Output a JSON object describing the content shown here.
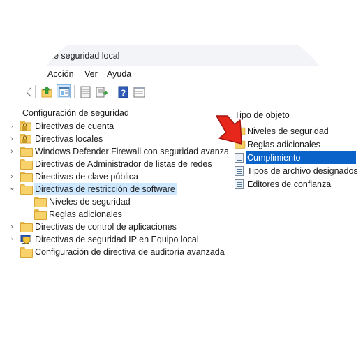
{
  "window": {
    "title": "de seguridad local"
  },
  "menu": {
    "items": [
      "Acción",
      "Ver",
      "Ayuda"
    ]
  },
  "toolbar": {
    "buttons": [
      "back-icon",
      "up-folder-icon",
      "show-hide-tree-icon",
      "properties-icon",
      "export-list-icon",
      "help-icon",
      "details-view-icon"
    ]
  },
  "tree": {
    "root": "Configuración de seguridad",
    "items": [
      {
        "label": "Directivas de cuenta",
        "expander": "›",
        "icon": "lock-folder-icon"
      },
      {
        "label": "Directivas locales",
        "expander": "›",
        "icon": "lock-folder-icon"
      },
      {
        "label": "Windows Defender Firewall con seguridad avanzada",
        "expander": "›",
        "icon": "folder-icon"
      },
      {
        "label": "Directivas de Administrador de listas de redes",
        "expander": "",
        "icon": "folder-icon"
      },
      {
        "label": "Directivas de clave pública",
        "expander": "›",
        "icon": "folder-icon"
      },
      {
        "label": "Directivas de restricción de software",
        "expander": "⌄",
        "icon": "folder-icon",
        "selected": true
      },
      {
        "label": "Niveles de seguridad",
        "expander": "",
        "icon": "folder-icon",
        "child": true
      },
      {
        "label": "Reglas adicionales",
        "expander": "",
        "icon": "folder-icon",
        "child": true
      },
      {
        "label": "Directivas de control de aplicaciones",
        "expander": "›",
        "icon": "folder-icon"
      },
      {
        "label": "Directivas de seguridad IP en Equipo local",
        "expander": "›",
        "icon": "shield-computer-icon"
      },
      {
        "label": "Configuración de directiva de auditoría avanzada",
        "expander": "›",
        "icon": "folder-icon"
      }
    ]
  },
  "list": {
    "header": "Tipo de objeto",
    "items": [
      {
        "label": "Niveles de seguridad",
        "icon": "folder-icon"
      },
      {
        "label": "Reglas adicionales",
        "icon": "folder-icon"
      },
      {
        "label": "Cumplimiento",
        "icon": "policy-object-icon",
        "selected": true
      },
      {
        "label": "Tipos de archivo designados",
        "icon": "policy-object-icon"
      },
      {
        "label": "Editores de confianza",
        "icon": "policy-object-icon"
      }
    ]
  },
  "colors": {
    "selection": "#0a63c9",
    "tree_selection": "#cde8ff",
    "arrow": "#e8271c"
  }
}
